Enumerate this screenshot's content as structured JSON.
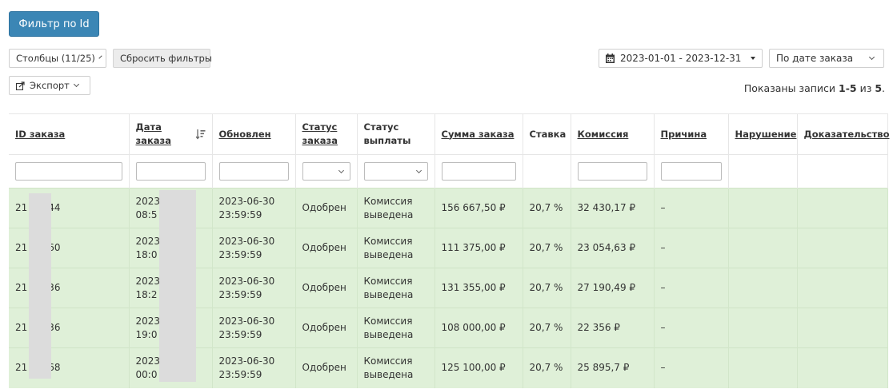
{
  "toolbar": {
    "filter_by_id_label": "Фильтр по Id",
    "columns_label": "Столбцы (11/25)",
    "reset_filters_label": "Сбросить фильтры",
    "export_label": "Экспорт",
    "date_range_value": "2023-01-01 - 2023-12-31",
    "date_mode_value": "По дате заказа"
  },
  "info": {
    "prefix": "Показаны записи ",
    "range": "1-5",
    "middle": " из ",
    "total": "5",
    "suffix": "."
  },
  "table": {
    "headers": [
      {
        "line1": "ID заказа",
        "line2": "",
        "sortable": true
      },
      {
        "line1": "Дата",
        "line2": "заказа",
        "sortable": true
      },
      {
        "line1": "Обновлен",
        "line2": "",
        "sortable": true
      },
      {
        "line1": "Статус",
        "line2": "заказа",
        "sortable": true
      },
      {
        "line1": "Статус",
        "line2": "выплаты",
        "sortable": false
      },
      {
        "line1": "Сумма заказа",
        "line2": "",
        "sortable": true
      },
      {
        "line1": "Ставка",
        "line2": "",
        "sortable": false
      },
      {
        "line1": "Комиссия",
        "line2": "",
        "sortable": true
      },
      {
        "line1": "Причина",
        "line2": "",
        "sortable": true
      },
      {
        "line1": "Нарушение",
        "line2": "",
        "sortable": true
      },
      {
        "line1": "Доказательство",
        "line2": "",
        "sortable": true
      }
    ],
    "rows": [
      {
        "id_a": "21",
        "id_b": "44",
        "date_a": "2023",
        "date_b": "08:5",
        "updated_a": "2023-06-30",
        "updated_b": "23:59:59",
        "order_status": "Одобрен",
        "pay_a": "Комиссия",
        "pay_b": "выведена",
        "sum": "156 667,50 ₽",
        "rate": "20,7 %",
        "commission": "32 430,17 ₽",
        "reason": "–"
      },
      {
        "id_a": "21",
        "id_b": "60",
        "date_a": "2023",
        "date_b": "18:0",
        "updated_a": "2023-06-30",
        "updated_b": "23:59:59",
        "order_status": "Одобрен",
        "pay_a": "Комиссия",
        "pay_b": "выведена",
        "sum": "111 375,00 ₽",
        "rate": "20,7 %",
        "commission": "23 054,63 ₽",
        "reason": "–"
      },
      {
        "id_a": "21",
        "id_b": "36",
        "date_a": "2023",
        "date_b": "18:2",
        "updated_a": "2023-06-30",
        "updated_b": "23:59:59",
        "order_status": "Одобрен",
        "pay_a": "Комиссия",
        "pay_b": "выведена",
        "sum": "131 355,00 ₽",
        "rate": "20,7 %",
        "commission": "27 190,49 ₽",
        "reason": "–"
      },
      {
        "id_a": "21",
        "id_b": "36",
        "date_a": "2023",
        "date_b": "19:0",
        "updated_a": "2023-06-30",
        "updated_b": "23:59:59",
        "order_status": "Одобрен",
        "pay_a": "Комиссия",
        "pay_b": "выведена",
        "sum": "108 000,00 ₽",
        "rate": "20,7 %",
        "commission": "22 356 ₽",
        "reason": "–"
      },
      {
        "id_a": "21",
        "id_b": "68",
        "date_a": "2023",
        "date_b": "00:0",
        "updated_a": "2023-06-30",
        "updated_b": "23:59:59",
        "order_status": "Одобрен",
        "pay_a": "Комиссия",
        "pay_b": "выведена",
        "sum": "125 100,00 ₽",
        "rate": "20,7 %",
        "commission": "25 895,7 ₽",
        "reason": "–"
      }
    ]
  },
  "colors": {
    "primary": "#3b86b5",
    "row_success": "#dff0d8",
    "dash_red": "#d9534f"
  }
}
